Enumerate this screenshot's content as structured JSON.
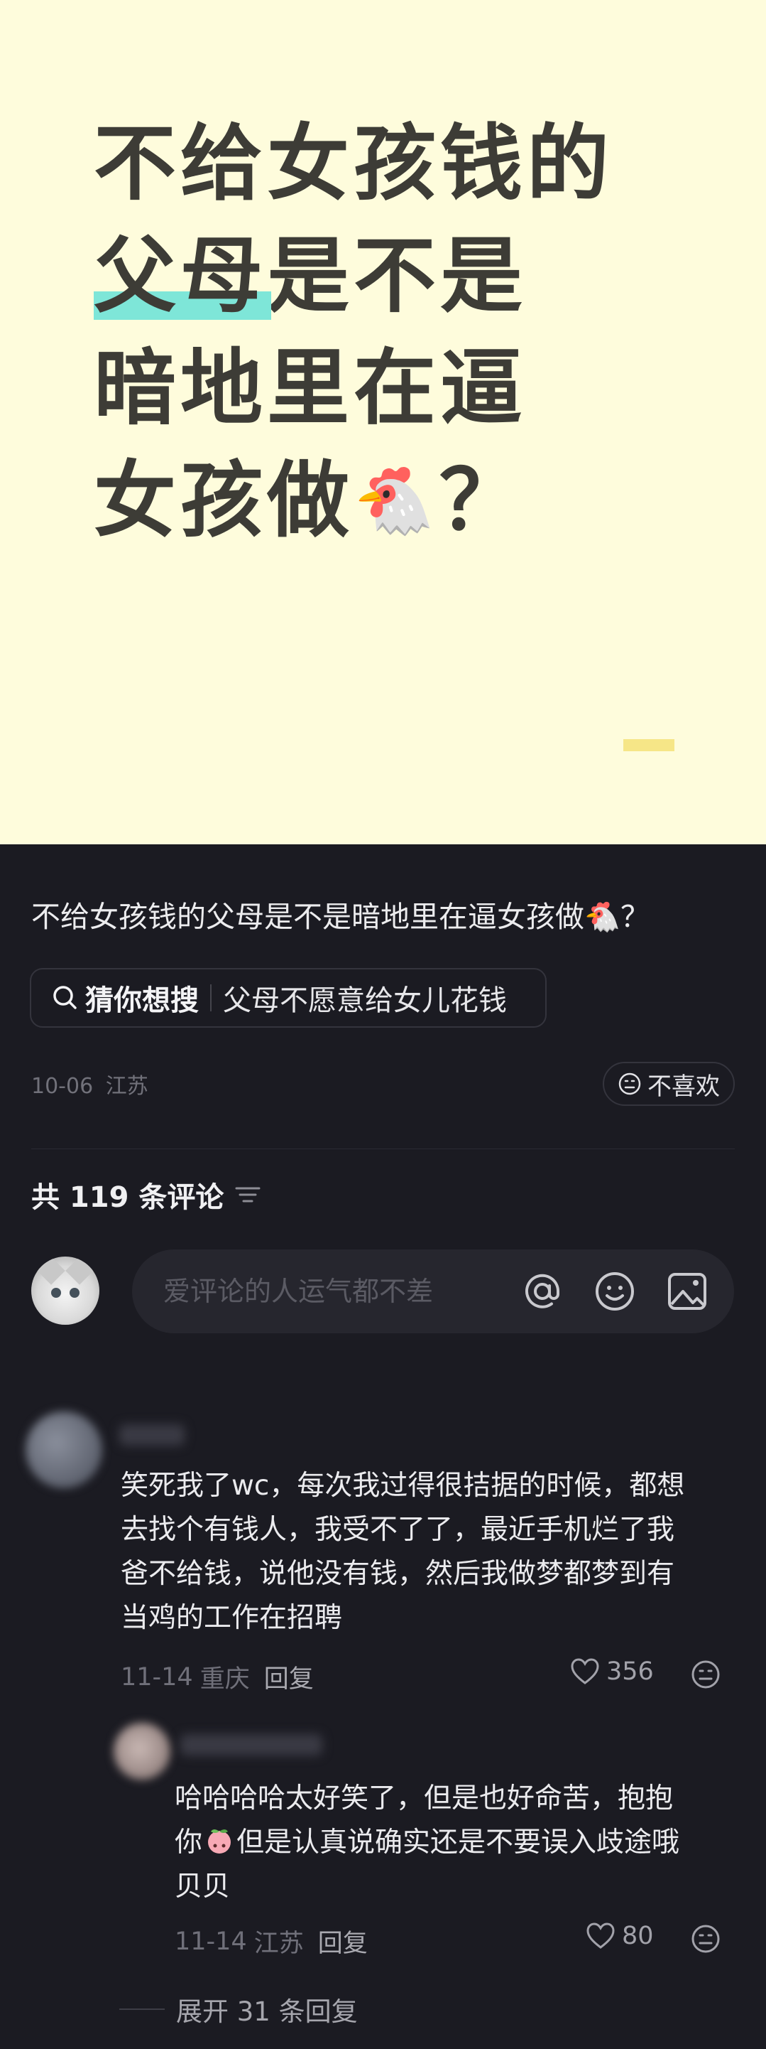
{
  "hero": {
    "lines": [
      "不给女孩钱的",
      "父母",
      "是不是",
      "暗地里在逼",
      "女孩做",
      "？"
    ]
  },
  "post": {
    "title": "不给女孩钱的父母是不是暗地里在逼女孩做🐔？",
    "guess_label": "猜你想搜",
    "guess_query": "父母不愿意给女儿花钱",
    "date": "10-06",
    "location": "江苏",
    "dislike_label": "不喜欢"
  },
  "comments_section": {
    "count_label": "共 119 条评论",
    "input_placeholder": "爱评论的人运气都不差"
  },
  "comments": [
    {
      "lines": [
        "笑死我了wc，每次我过得很拮据的时候，都想",
        "去找个有钱人，我受不了了，最近手机烂了我",
        "爸不给钱，说他没有钱，然后我做梦都梦到有",
        "当鸡的工作在招聘"
      ],
      "date": "11-14",
      "location": "重庆",
      "reply_label": "回复",
      "likes": "356"
    },
    {
      "line1": "哈哈哈哈太好笑了，但是也好命苦，抱抱",
      "line2_a": "你",
      "line2_b": "但是认真说确实还是不要误入歧途哦",
      "line3": "贝贝",
      "date": "11-14",
      "location": "江苏",
      "reply_label": "回复",
      "likes": "80"
    }
  ],
  "expand_label": "展开 31 条回复",
  "colors": {
    "hero_bg": "#fefcdc",
    "highlight": "#7ee6d8",
    "deco": "#f6e687",
    "page_bg": "#1b1b22"
  }
}
